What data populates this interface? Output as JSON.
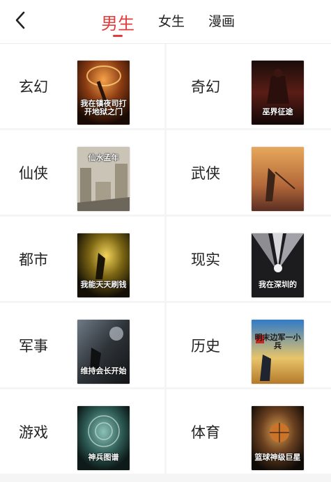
{
  "header": {
    "tabs": [
      {
        "label": "男生",
        "active": true
      },
      {
        "label": "女生",
        "active": false
      },
      {
        "label": "漫画",
        "active": false
      }
    ]
  },
  "categories": [
    {
      "label": "玄幻",
      "cover_title": "我在镇夜司打开地狱之门"
    },
    {
      "label": "奇幻",
      "cover_title": "巫界征途"
    },
    {
      "label": "仙侠",
      "cover_title": "仙水孟年"
    },
    {
      "label": "武侠",
      "cover_title": ""
    },
    {
      "label": "都市",
      "cover_title": "我能天天刷钱"
    },
    {
      "label": "现实",
      "cover_title": "我在深圳的"
    },
    {
      "label": "军事",
      "cover_title": "维持会长开始"
    },
    {
      "label": "历史",
      "cover_title": "明末边军一小兵"
    },
    {
      "label": "游戏",
      "cover_title": "神兵图谱"
    },
    {
      "label": "体育",
      "cover_title": "篮球神级巨星"
    }
  ],
  "colors": {
    "accent": "#e23b3b",
    "background": "#f5f5f5",
    "card": "#ffffff"
  },
  "icons": {
    "back": "chevron-left-icon"
  }
}
